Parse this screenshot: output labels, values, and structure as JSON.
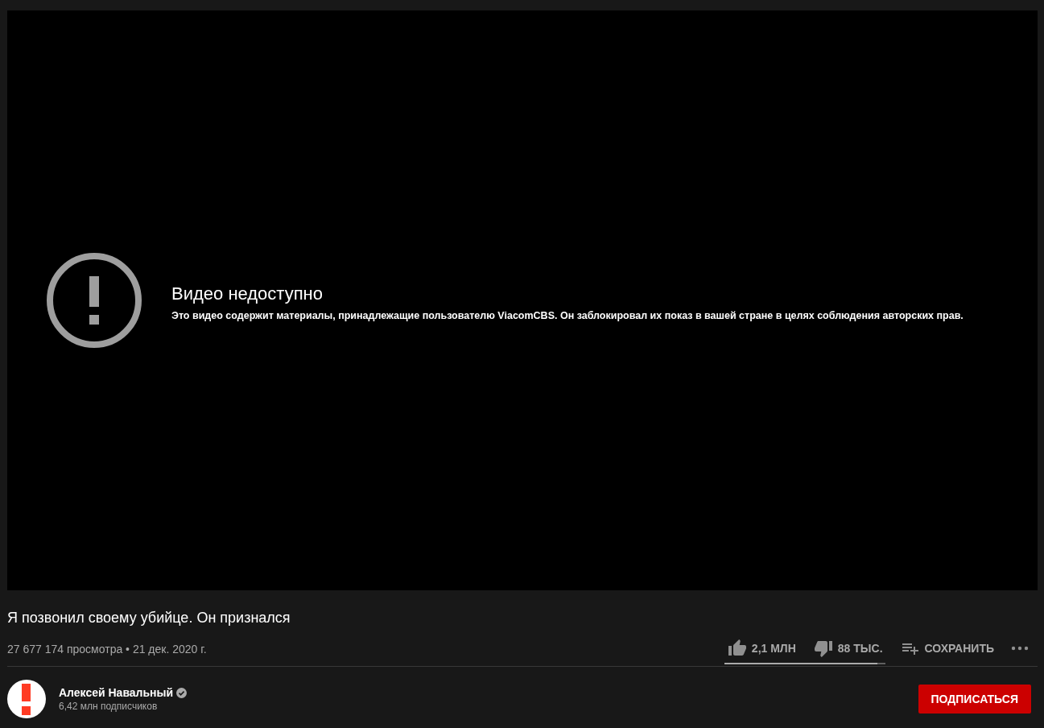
{
  "player": {
    "error_title": "Видео недоступно",
    "error_message": "Это видео содержит материалы, принадлежащие пользователю ViacomCBS. Он заблокировал их показ в вашей стране в целях соблюдения авторских прав."
  },
  "video": {
    "title": "Я позвонил своему убийце. Он признался",
    "views": "27 677 174 просмотра",
    "separator": "•",
    "date": "21 дек. 2020 г."
  },
  "actions": {
    "likes": "2,1 МЛН",
    "dislikes": "88 ТЫС.",
    "save": "СОХРАНИТЬ",
    "sentiment": {
      "level": 0.95
    }
  },
  "channel": {
    "name": "Алексей Навальный",
    "verified": true,
    "subscribers": "6,42 млн подписчиков",
    "subscribe_button": "ПОДПИСАТЬСЯ"
  }
}
